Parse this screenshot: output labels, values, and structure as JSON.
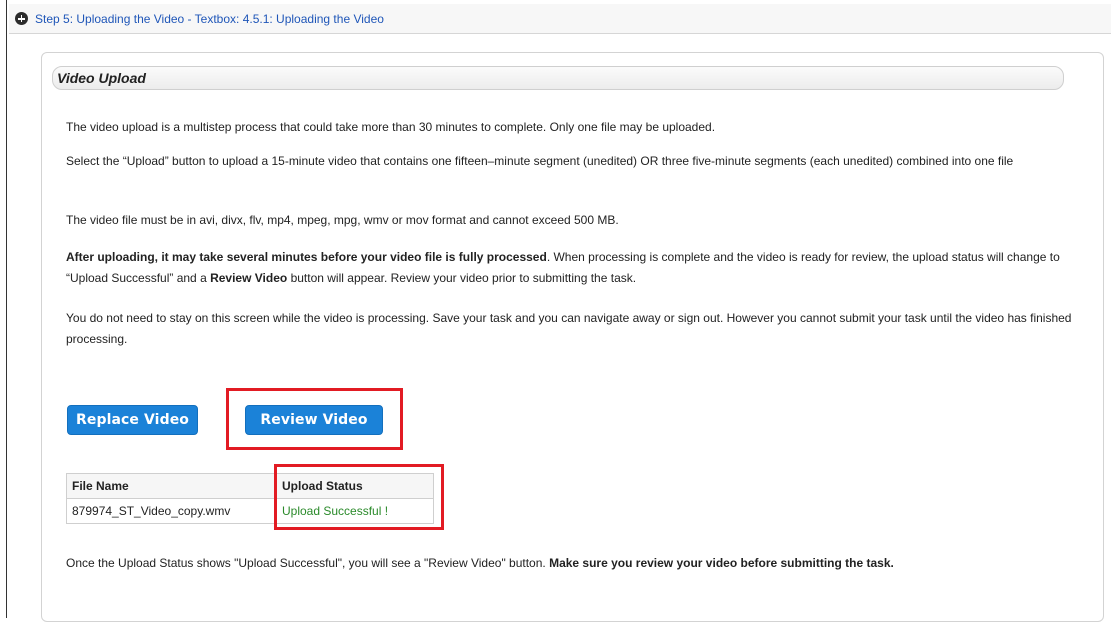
{
  "step": {
    "title": "Step 5: Uploading the Video - Textbox: 4.5.1: Uploading the Video"
  },
  "panel": {
    "title": "Video Upload",
    "paragraphs": {
      "p1": "The video upload is a multistep process that could take more than 30 minutes to complete. Only one file may be uploaded.",
      "p2": "Select the “Upload” button to upload a 15-minute video that contains one fifteen–minute segment (unedited) OR three five-minute segments (each unedited) combined into one file",
      "p3": "The video file must be in avi, divx, flv, mp4, mpeg, mpg, wmv or mov format and cannot exceed 500 MB.",
      "p4_bold": "After uploading, it may take several minutes before your video file is fully processed",
      "p4_mid": ". When processing is complete and the video is ready for review, the upload status will change to “Upload Successful” and a ",
      "p4_bold2": "Review Video",
      "p4_end": " button will appear. Review your video prior to submitting the task.",
      "p5": "You do not need to stay on this screen while the video is processing. Save your task and you can navigate away or sign out. However you cannot submit your task until the video has finished processing.",
      "p6_start": "Once the Upload Status shows \"Upload Successful\", you will see a \"Review Video\" button. ",
      "p6_bold": "Make sure you review your video before submitting the task."
    },
    "buttons": {
      "replace": "Replace Video",
      "review": "Review Video"
    },
    "table": {
      "headers": [
        "File Name",
        "Upload Status"
      ],
      "rows": [
        {
          "file_name": "879974_ST_Video_copy.wmv",
          "status": "Upload Successful !"
        }
      ]
    }
  },
  "colors": {
    "link_blue": "#1f56b8",
    "button_blue": "#1b82d8",
    "success_green": "#2a8a2a",
    "highlight_red": "#e21b23"
  },
  "icons": {
    "step_toggle": "plus-circle-icon"
  }
}
